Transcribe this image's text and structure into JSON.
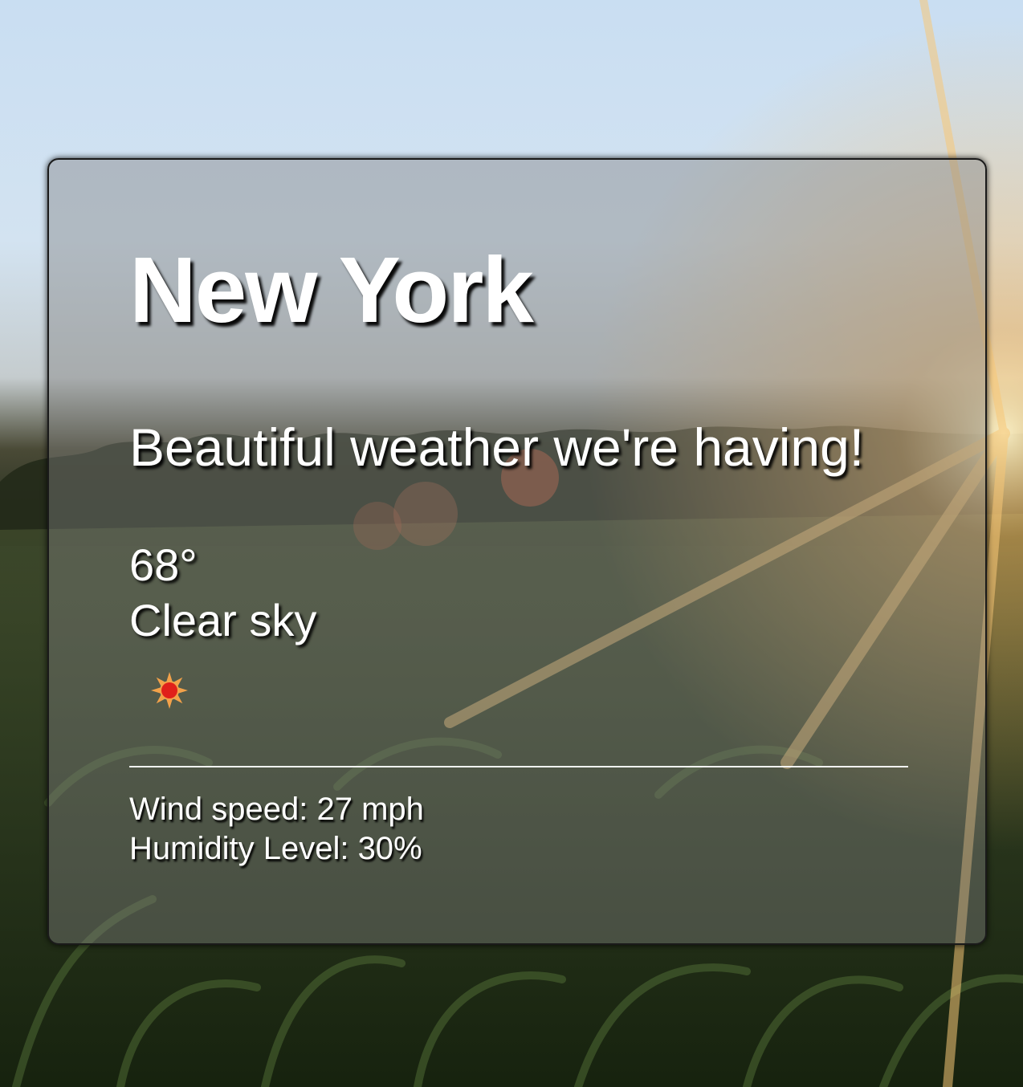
{
  "weather_card": {
    "city": "New York",
    "tagline": "Beautiful weather we're having!",
    "temperature": "68°",
    "condition": "Clear sky",
    "condition_icon": "sun-icon",
    "wind": {
      "label": "Wind speed: ",
      "value": "27",
      "unit": " mph"
    },
    "humidity": {
      "label": "Humidity Level: ",
      "value": "30",
      "unit": "%"
    }
  },
  "colors": {
    "text": "#ffffff",
    "card_overlay": "rgba(128,128,128,0.42)",
    "card_border": "#1a1a1a",
    "sun_core": "#e0201a",
    "sun_rays": "#f2a24a"
  },
  "background": {
    "scene": "sunset-cornfield-photo"
  }
}
